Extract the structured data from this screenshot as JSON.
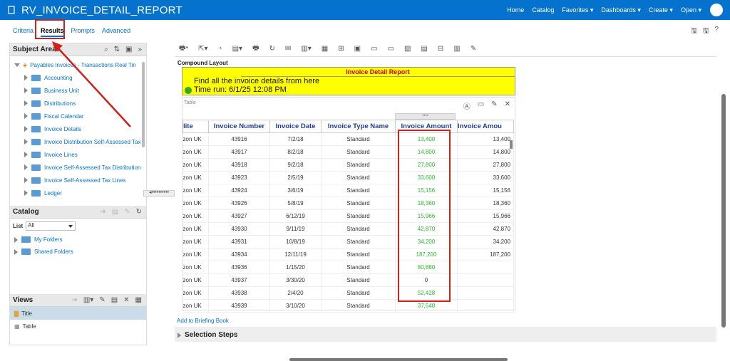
{
  "app": {
    "title": "RV_INVOICE_DETAIL_REPORT",
    "nav": [
      "Home",
      "Catalog",
      "Favorites ▾",
      "Dashboards ▾",
      "Create ▾",
      "Open ▾"
    ]
  },
  "tabs": [
    "Criteria",
    "Results",
    "Prompts",
    "Advanced"
  ],
  "subject_areas": {
    "header": "Subject Areas",
    "root": "Payables Invoices - Transactions Real Tin",
    "items": [
      "Accounting",
      "Business Unit",
      "Distributions",
      "Fiscal Calendar",
      "Invoice Details",
      "Invoice Distribution Self-Assessed Tax",
      "Invoice Lines",
      "Invoice Self-Assessed Tax Distribution",
      "Invoice Self-Assessed Tax Lines",
      "Ledger"
    ]
  },
  "catalog": {
    "header": "Catalog",
    "list_label": "List",
    "list_value": "All",
    "items": [
      "My Folders",
      "Shared Folders"
    ]
  },
  "views": {
    "header": "Views",
    "items": [
      "Title",
      "Table"
    ]
  },
  "compound": {
    "label": "Compound Layout",
    "report_title": "Invoice Detail Report",
    "line1": "Find all the invoice details from here",
    "line2": "Time run: 6/1/25 12:08 PM"
  },
  "table": {
    "label": "Table",
    "headers": [
      "lite",
      "Invoice Number",
      "Invoice Date",
      "Invoice Type Name",
      "Invoice Amount",
      "Invoice Amou"
    ],
    "rows": [
      [
        "zon UK",
        "43916",
        "7/2/18",
        "Standard",
        "13,400",
        "13,400"
      ],
      [
        "zon UK",
        "43917",
        "8/2/18",
        "Standard",
        "14,800",
        "14,800"
      ],
      [
        "zon UK",
        "43918",
        "9/2/18",
        "Standard",
        "27,800",
        "27,800"
      ],
      [
        "zon UK",
        "43923",
        "2/5/19",
        "Standard",
        "33,600",
        "33,600"
      ],
      [
        "zon UK",
        "43924",
        "3/6/19",
        "Standard",
        "15,156",
        "15,156"
      ],
      [
        "zon UK",
        "43926",
        "5/8/19",
        "Standard",
        "18,360",
        "18,360"
      ],
      [
        "zon UK",
        "43927",
        "6/12/19",
        "Standard",
        "15,966",
        "15,966"
      ],
      [
        "zon UK",
        "43930",
        "9/11/19",
        "Standard",
        "42,870",
        "42,870"
      ],
      [
        "zon UK",
        "43931",
        "10/8/19",
        "Standard",
        "34,200",
        "34,200"
      ],
      [
        "zon UK",
        "43934",
        "12/11/19",
        "Standard",
        "187,200",
        "187,200"
      ],
      [
        "zon UK",
        "43936",
        "1/15/20",
        "Standard",
        "80,880",
        ""
      ],
      [
        "zon UK",
        "43937",
        "3/30/20",
        "Standard",
        "0",
        ""
      ],
      [
        "zon UK",
        "43938",
        "2/4/20",
        "Standard",
        "52,428",
        ""
      ],
      [
        "zon UK",
        "43939",
        "3/10/20",
        "Standard",
        "37,548",
        ""
      ]
    ]
  },
  "footer": {
    "briefing": "Add to Briefing Book",
    "selection_steps": "Selection Steps"
  },
  "colors": {
    "brand": "#0572ce",
    "highlight": "#d0201a",
    "amount_green": "#2cb82c",
    "title_band": "#ffff00"
  }
}
